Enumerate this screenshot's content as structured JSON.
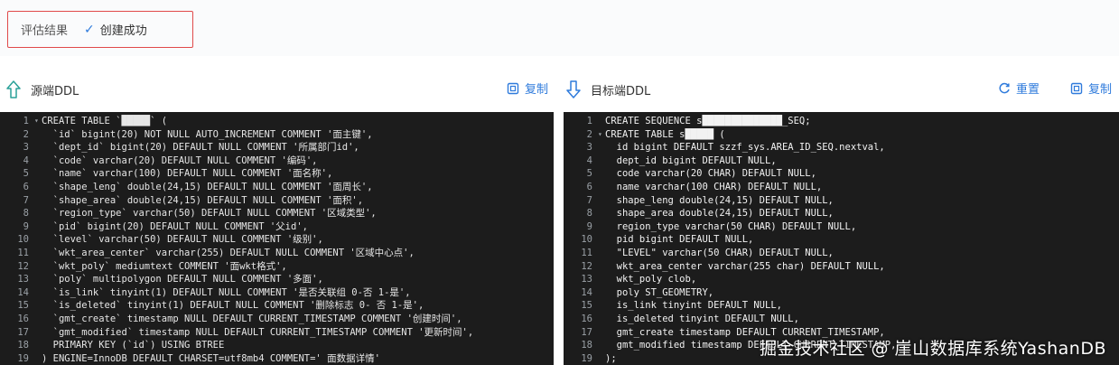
{
  "result": {
    "label": "评估结果",
    "status": "创建成功"
  },
  "source": {
    "title": "源端DDL",
    "copy_label": "复制",
    "lines": [
      "CREATE TABLE `█████` (",
      "  `id` bigint(20) NOT NULL AUTO_INCREMENT COMMENT '面主键',",
      "  `dept_id` bigint(20) DEFAULT NULL COMMENT '所属部门id',",
      "  `code` varchar(20) DEFAULT NULL COMMENT '编码',",
      "  `name` varchar(100) DEFAULT NULL COMMENT '面名称',",
      "  `shape_leng` double(24,15) DEFAULT NULL COMMENT '面周长',",
      "  `shape_area` double(24,15) DEFAULT NULL COMMENT '面积',",
      "  `region_type` varchar(50) DEFAULT NULL COMMENT '区域类型',",
      "  `pid` bigint(20) DEFAULT NULL COMMENT '父id',",
      "  `level` varchar(50) DEFAULT NULL COMMENT '级别',",
      "  `wkt_area_center` varchar(255) DEFAULT NULL COMMENT '区域中心点',",
      "  `wkt_poly` mediumtext COMMENT '面wkt格式',",
      "  `poly` multipolygon DEFAULT NULL COMMENT '多面',",
      "  `is_link` tinyint(1) DEFAULT NULL COMMENT '是否关联组 0-否 1-是',",
      "  `is_deleted` tinyint(1) DEFAULT NULL COMMENT '删除标志 0- 否 1-是',",
      "  `gmt_create` timestamp NULL DEFAULT CURRENT_TIMESTAMP COMMENT '创建时间',",
      "  `gmt_modified` timestamp NULL DEFAULT CURRENT_TIMESTAMP COMMENT '更新时间',",
      "  PRIMARY KEY (`id`) USING BTREE",
      ") ENGINE=InnoDB DEFAULT CHARSET=utf8mb4 COMMENT=' 面数据详情'"
    ]
  },
  "target": {
    "title": "目标端DDL",
    "reset_label": "重置",
    "copy_label": "复制",
    "lines": [
      "CREATE SEQUENCE s██████████████_SEQ;",
      "CREATE TABLE s█████ (",
      "  id bigint DEFAULT szzf_sys.AREA_ID_SEQ.nextval,",
      "  dept_id bigint DEFAULT NULL,",
      "  code varchar(20 CHAR) DEFAULT NULL,",
      "  name varchar(100 CHAR) DEFAULT NULL,",
      "  shape_leng double(24,15) DEFAULT NULL,",
      "  shape_area double(24,15) DEFAULT NULL,",
      "  region_type varchar(50 CHAR) DEFAULT NULL,",
      "  pid bigint DEFAULT NULL,",
      "  \"LEVEL\" varchar(50 CHAR) DEFAULT NULL,",
      "  wkt_area_center varchar(255 char) DEFAULT NULL,",
      "  wkt_poly clob,",
      "  poly ST_GEOMETRY,",
      "  is_link tinyint DEFAULT NULL,",
      "  is_deleted tinyint DEFAULT NULL,",
      "  gmt_create timestamp DEFAULT CURRENT_TIMESTAMP,",
      "  gmt_modified timestamp DEFAULT CURRENT_TIMESTAMP,",
      ");"
    ]
  },
  "watermark": "掘金技术社区 @ 崖山数据库系统YashanDB",
  "colors": {
    "accent": "#2f7bdc",
    "highlight_border": "#e04a4a",
    "editor_bg": "#1c1c1c"
  }
}
